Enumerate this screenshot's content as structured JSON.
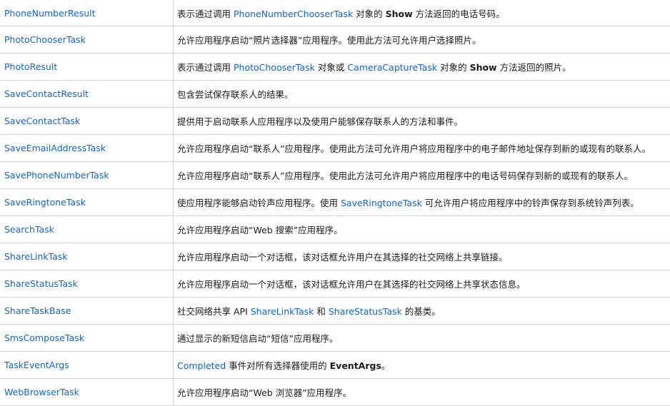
{
  "rows": [
    {
      "name": "PhoneNumberResult",
      "parts": [
        {
          "t": "表示通过调用 "
        },
        {
          "t": "PhoneNumberChooserTask",
          "link": true
        },
        {
          "t": " 对象的 "
        },
        {
          "t": "Show",
          "bold": true
        },
        {
          "t": " 方法返回的电话号码。"
        }
      ]
    },
    {
      "name": "PhotoChooserTask",
      "parts": [
        {
          "t": "允许应用程序启动“照片选择器”应用程序。使用此方法可允许用户选择照片。"
        }
      ]
    },
    {
      "name": "PhotoResult",
      "parts": [
        {
          "t": "表示通过调用 "
        },
        {
          "t": "PhotoChooserTask",
          "link": true
        },
        {
          "t": " 对象或 "
        },
        {
          "t": "CameraCaptureTask",
          "link": true
        },
        {
          "t": " 对象的 "
        },
        {
          "t": "Show",
          "bold": true
        },
        {
          "t": " 方法返回的照片。"
        }
      ]
    },
    {
      "name": "SaveContactResult",
      "parts": [
        {
          "t": "包含尝试保存联系人的结果。"
        }
      ]
    },
    {
      "name": "SaveContactTask",
      "parts": [
        {
          "t": "提供用于启动联系人应用程序以及使用户能够保存联系人的方法和事件。"
        }
      ]
    },
    {
      "name": "SaveEmailAddressTask",
      "parts": [
        {
          "t": "允许应用程序启动“联系人”应用程序。使用此方法可允许用户将应用程序中的电子邮件地址保存到新的或现有的联系人。"
        }
      ]
    },
    {
      "name": "SavePhoneNumberTask",
      "parts": [
        {
          "t": "允许应用程序启动“联系人”应用程序。使用此方法可允许用户将应用程序中的电话号码保存到新的或现有的联系人。"
        }
      ]
    },
    {
      "name": "SaveRingtoneTask",
      "parts": [
        {
          "t": "使应用程序能够启动铃声应用程序。使用 "
        },
        {
          "t": "SaveRingtoneTask",
          "link": true
        },
        {
          "t": " 可允许用户将应用程序中的铃声保存到系统铃声列表。"
        }
      ]
    },
    {
      "name": "SearchTask",
      "parts": [
        {
          "t": "允许应用程序启动“Web 搜索”应用程序。"
        }
      ]
    },
    {
      "name": "ShareLinkTask",
      "parts": [
        {
          "t": "允许应用程序启动一个对话框，该对话框允许用户在其选择的社交网络上共享链接。"
        }
      ]
    },
    {
      "name": "ShareStatusTask",
      "parts": [
        {
          "t": "允许应用程序启动一个对话框，该对话框允许用户在其选择的社交网络上共享状态信息。"
        }
      ]
    },
    {
      "name": "ShareTaskBase",
      "parts": [
        {
          "t": "社交网络共享 API "
        },
        {
          "t": "ShareLinkTask",
          "link": true
        },
        {
          "t": " 和 "
        },
        {
          "t": "ShareStatusTask",
          "link": true
        },
        {
          "t": " 的基类。"
        }
      ]
    },
    {
      "name": "SmsComposeTask",
      "parts": [
        {
          "t": "通过显示的新短信启动“短信”应用程序。"
        }
      ]
    },
    {
      "name": "TaskEventArgs",
      "parts": [
        {
          "t": "Completed",
          "link": true
        },
        {
          "t": " 事件对所有选择器使用的 "
        },
        {
          "t": "EventArgs",
          "bold": true
        },
        {
          "t": "。"
        }
      ]
    },
    {
      "name": "WebBrowserTask",
      "parts": [
        {
          "t": "允许应用程序启动“Web 浏览器”应用程序。"
        }
      ]
    }
  ],
  "colors": {
    "link": "#1364c4",
    "border": "#d5d5d5",
    "text": "#1a1a1a"
  }
}
